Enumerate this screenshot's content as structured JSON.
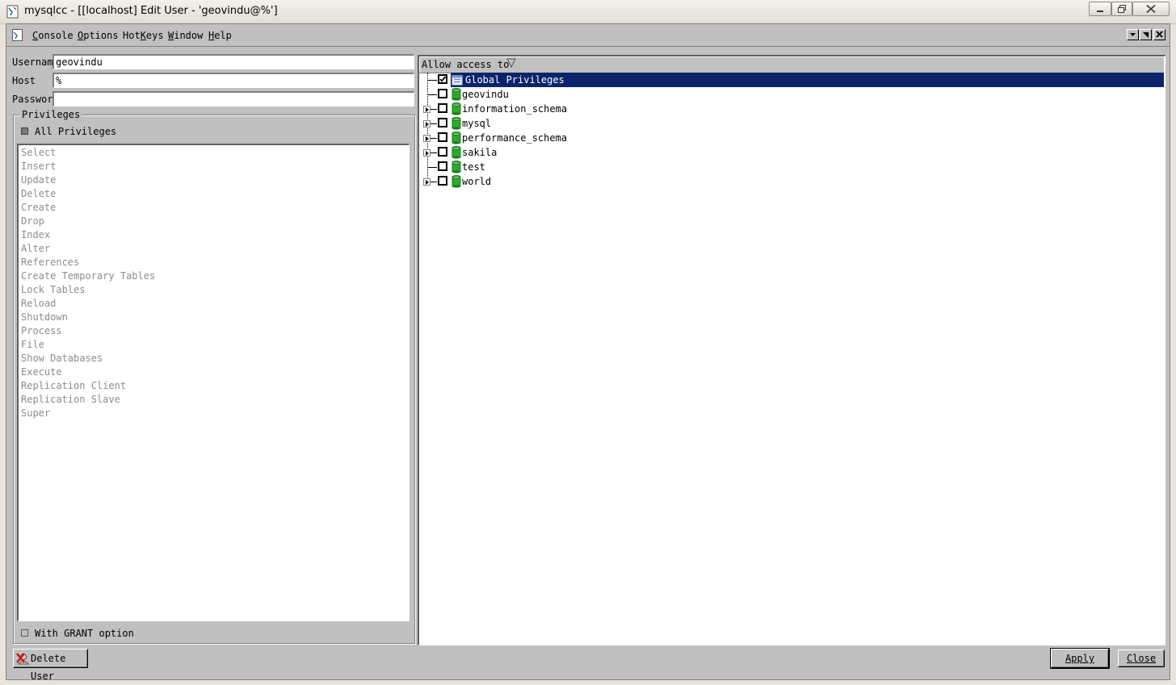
{
  "window": {
    "title": "mysqlcc - [[localhost] Edit User - 'geovindu@%']"
  },
  "menu": {
    "items": [
      {
        "id": "console",
        "label": "Console",
        "accel": "C",
        "rest": "onsole"
      },
      {
        "id": "options",
        "label": "Options",
        "accel": "O",
        "rest": "ptions"
      },
      {
        "id": "hotkeys",
        "label": "HotKeys",
        "accel": "",
        "pre": "Hot",
        "accelMid": "K",
        "rest": "eys"
      },
      {
        "id": "window",
        "label": "Window",
        "accel": "W",
        "rest": "indow"
      },
      {
        "id": "help",
        "label": "Help",
        "accel": "H",
        "rest": "elp"
      }
    ]
  },
  "form": {
    "username_label": "Username",
    "username_value": "geovindu",
    "host_label": "Host",
    "host_value": "%",
    "password_label": "Password",
    "password_value": ""
  },
  "privileges": {
    "group_label": "Privileges",
    "all_label": "All Privileges",
    "items": [
      "Select",
      "Insert",
      "Update",
      "Delete",
      "Create",
      "Drop",
      "Index",
      "Alter",
      "References",
      "Create Temporary Tables",
      "Lock Tables",
      "Reload",
      "Shutdown",
      "Process",
      "File",
      "Show Databases",
      "Execute",
      "Replication Client",
      "Replication Slave",
      "Super"
    ],
    "grant_label": "With GRANT option"
  },
  "tree": {
    "header": "Allow access to",
    "nodes": [
      {
        "label": "Global Privileges",
        "checked": true,
        "expandable": false,
        "selected": true,
        "icon": "global-privileges-icon"
      },
      {
        "label": "geovindu",
        "checked": false,
        "expandable": false,
        "selected": false,
        "icon": "database-icon"
      },
      {
        "label": "information_schema",
        "checked": false,
        "expandable": true,
        "selected": false,
        "icon": "database-icon"
      },
      {
        "label": "mysql",
        "checked": false,
        "expandable": true,
        "selected": false,
        "icon": "database-icon"
      },
      {
        "label": "performance_schema",
        "checked": false,
        "expandable": true,
        "selected": false,
        "icon": "database-icon"
      },
      {
        "label": "sakila",
        "checked": false,
        "expandable": true,
        "selected": false,
        "icon": "database-icon"
      },
      {
        "label": "test",
        "checked": false,
        "expandable": false,
        "selected": false,
        "icon": "database-icon"
      },
      {
        "label": "world",
        "checked": false,
        "expandable": true,
        "selected": false,
        "icon": "database-icon"
      }
    ]
  },
  "buttons": {
    "delete_user": "Delete User",
    "apply": "Apply",
    "close": "Close"
  },
  "colors": {
    "face": "#c0c0c0",
    "selection": "#0a246a",
    "disabled_text": "#8c8c8c",
    "db_icon": "#2fa82f"
  }
}
